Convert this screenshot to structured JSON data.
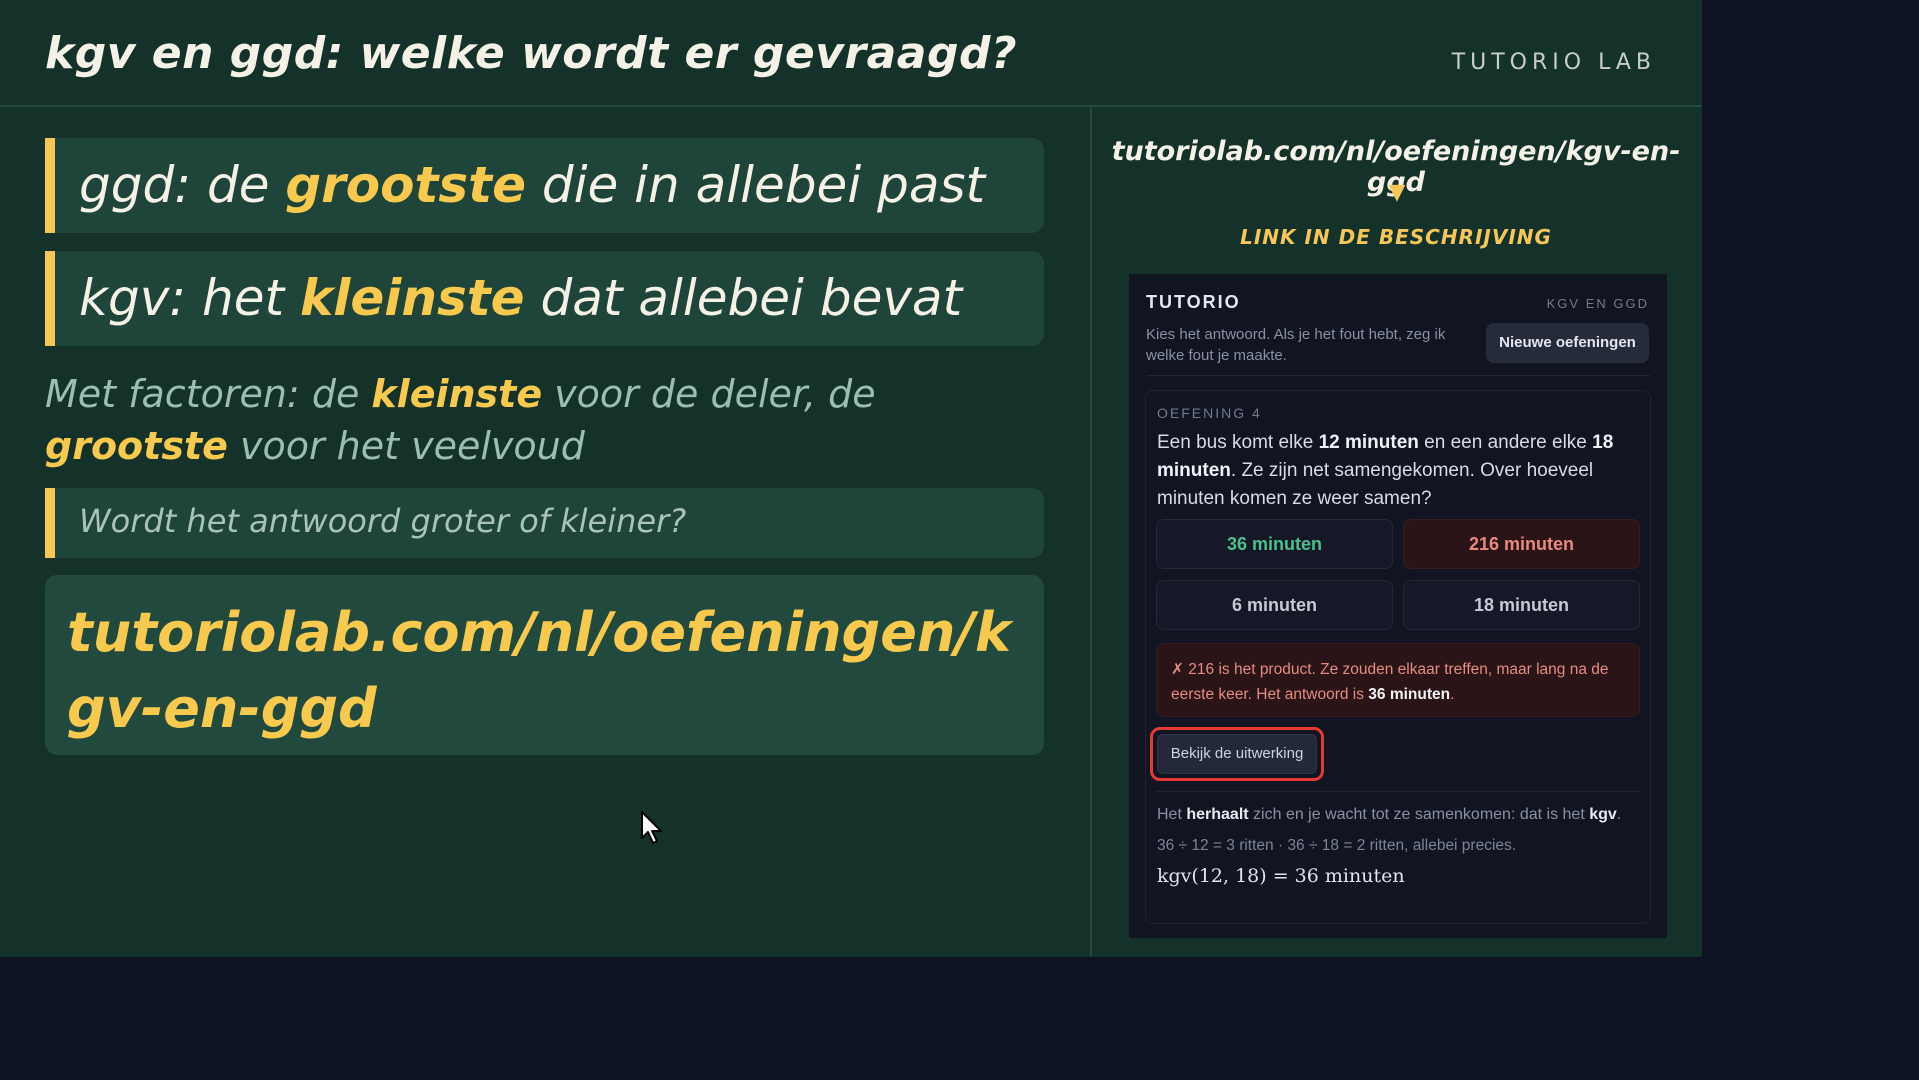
{
  "header": {
    "title": "kgv en ggd: welke wordt er gevraagd?",
    "brand": "TUTORIO LAB"
  },
  "cards": {
    "ggd": {
      "prefix": "ggd: de ",
      "highlight": "grootste",
      "suffix": " die in allebei past"
    },
    "kgv": {
      "prefix": "kgv: het ",
      "highlight": "kleinste",
      "suffix": " dat allebei bevat"
    },
    "factoren": {
      "part1": "Met factoren: de ",
      "hl1": "kleinste",
      "part2": " voor de deler, de ",
      "hl2": "grootste",
      "part3": " voor het veelvoud"
    },
    "question": "Wordt het antwoord groter of kleiner?",
    "url": "tutoriolab.com/nl/oefeningen/kgv-en-ggd"
  },
  "side": {
    "url": "tutoriolab.com/nl/oefeningen/kgv-en-ggd",
    "arrow": "▼",
    "link_label": "LINK IN DE BESCHRIJVING"
  },
  "app": {
    "brand": "TUTORIO",
    "topic": "KGV EN GGD",
    "intro": "Kies het antwoord. Als je het fout hebt, zeg ik welke fout je maakte.",
    "new_button": "Nieuwe oefeningen",
    "exercise": {
      "label": "OEFENING 4",
      "q1": "Een bus komt elke ",
      "q_b1": "12 minuten",
      "q2": " en een andere elke ",
      "q_b2": "18 minuten",
      "q3": ". Ze zijn net samengekomen. Over hoeveel minuten komen ze weer samen?",
      "options": [
        "36 minuten",
        "216 minuten",
        "6 minuten",
        "18 minuten"
      ],
      "feedback_text": "✗ 216 is het product. Ze zouden elkaar treffen, maar lang na de eerste keer. Het antwoord is ",
      "feedback_bold": "36 minuten",
      "feedback_end": ".",
      "work_button": "Bekijk de uitwerking",
      "expl1_a": "Het ",
      "expl1_b": "herhaalt",
      "expl1_c": " zich en je wacht tot ze samenkomen: dat is het ",
      "expl1_d": "kgv",
      "expl1_e": ".",
      "expl2": "36 ÷ 12 = 3 ritten  ·  36 ÷ 18 = 2 ritten, allebei precies.",
      "expl3": "kgv(12, 18) = 36 minuten"
    }
  },
  "colors": {
    "board": "#14312a",
    "card": "#1f4439",
    "accent": "#f5c75a",
    "app_bg": "#111421",
    "correct": "#4cc08a",
    "wrong": "#e78a7e",
    "highlight_ring": "#e53935"
  }
}
